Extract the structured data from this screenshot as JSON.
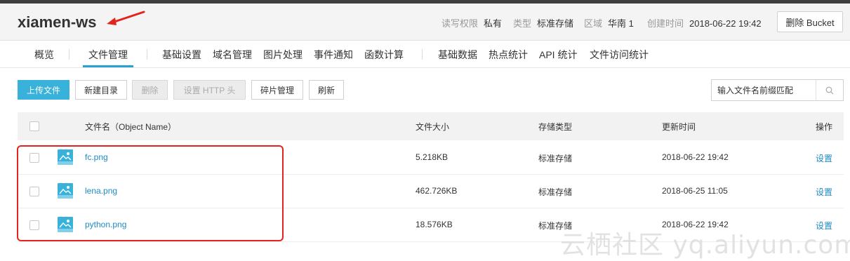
{
  "header": {
    "bucket_name": "xiamen-ws",
    "acl_label": "读写权限",
    "acl_value": "私有",
    "type_label": "类型",
    "type_value": "标准存储",
    "region_label": "区域",
    "region_value": "华南 1",
    "created_label": "创建时间",
    "created_value": "2018-06-22 19:42",
    "delete_bucket_label": "删除 Bucket"
  },
  "tabs": [
    {
      "label": "概览"
    },
    {
      "label": "文件管理",
      "active": true
    },
    {
      "label": "基础设置"
    },
    {
      "label": "域名管理"
    },
    {
      "label": "图片处理"
    },
    {
      "label": "事件通知"
    },
    {
      "label": "函数计算"
    },
    {
      "label": "基础数据"
    },
    {
      "label": "热点统计"
    },
    {
      "label": "API 统计"
    },
    {
      "label": "文件访问统计"
    }
  ],
  "toolbar": {
    "upload": "上传文件",
    "new_dir": "新建目录",
    "delete": "删除",
    "http_header": "设置 HTTP 头",
    "fragments": "碎片管理",
    "refresh": "刷新"
  },
  "search": {
    "placeholder": "输入文件名前缀匹配"
  },
  "table": {
    "columns": [
      "文件名（Object Name）",
      "文件大小",
      "存储类型",
      "更新时间",
      "操作"
    ],
    "rows": [
      {
        "name": "fc.png",
        "size": "5.218KB",
        "storage": "标准存储",
        "updated": "2018-06-22 19:42",
        "action": "设置"
      },
      {
        "name": "lena.png",
        "size": "462.726KB",
        "storage": "标准存储",
        "updated": "2018-06-25 11:05",
        "action": "设置"
      },
      {
        "name": "python.png",
        "size": "18.576KB",
        "storage": "标准存储",
        "updated": "2018-06-22 19:42",
        "action": "设置"
      }
    ]
  },
  "watermark": "云栖社区 yq.aliyun.com",
  "colors": {
    "accent": "#38b2da",
    "link": "#1e8bc3",
    "highlight": "#e2241c"
  },
  "icons": {
    "file_type": "image-file-icon",
    "search": "search-icon",
    "annotation": "red-arrow-icon"
  }
}
